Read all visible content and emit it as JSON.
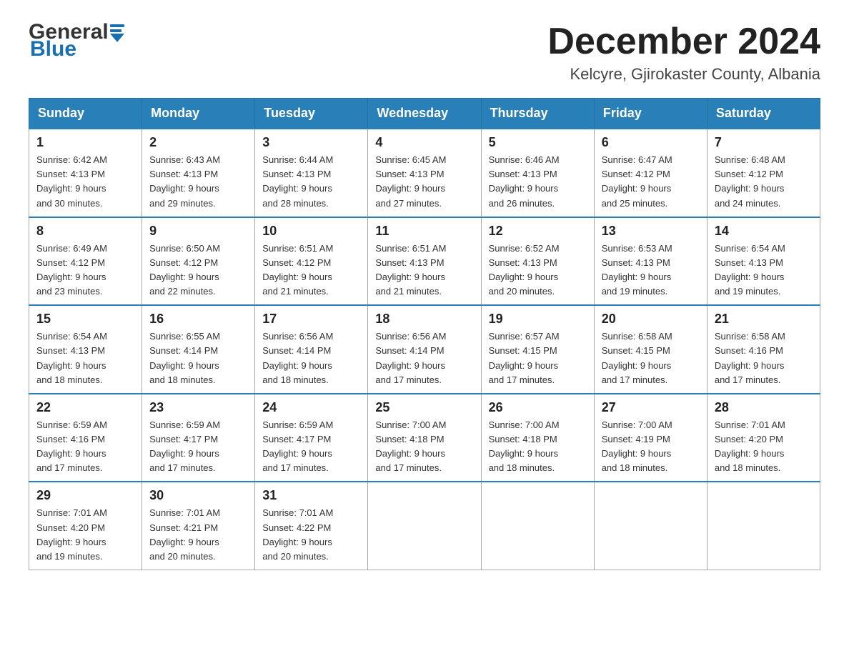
{
  "header": {
    "logo_general": "General",
    "logo_blue": "Blue",
    "month_title": "December 2024",
    "location": "Kelcyre, Gjirokaster County, Albania"
  },
  "days_of_week": [
    "Sunday",
    "Monday",
    "Tuesday",
    "Wednesday",
    "Thursday",
    "Friday",
    "Saturday"
  ],
  "weeks": [
    [
      {
        "day": "1",
        "sunrise": "6:42 AM",
        "sunset": "4:13 PM",
        "daylight": "9 hours and 30 minutes."
      },
      {
        "day": "2",
        "sunrise": "6:43 AM",
        "sunset": "4:13 PM",
        "daylight": "9 hours and 29 minutes."
      },
      {
        "day": "3",
        "sunrise": "6:44 AM",
        "sunset": "4:13 PM",
        "daylight": "9 hours and 28 minutes."
      },
      {
        "day": "4",
        "sunrise": "6:45 AM",
        "sunset": "4:13 PM",
        "daylight": "9 hours and 27 minutes."
      },
      {
        "day": "5",
        "sunrise": "6:46 AM",
        "sunset": "4:13 PM",
        "daylight": "9 hours and 26 minutes."
      },
      {
        "day": "6",
        "sunrise": "6:47 AM",
        "sunset": "4:12 PM",
        "daylight": "9 hours and 25 minutes."
      },
      {
        "day": "7",
        "sunrise": "6:48 AM",
        "sunset": "4:12 PM",
        "daylight": "9 hours and 24 minutes."
      }
    ],
    [
      {
        "day": "8",
        "sunrise": "6:49 AM",
        "sunset": "4:12 PM",
        "daylight": "9 hours and 23 minutes."
      },
      {
        "day": "9",
        "sunrise": "6:50 AM",
        "sunset": "4:12 PM",
        "daylight": "9 hours and 22 minutes."
      },
      {
        "day": "10",
        "sunrise": "6:51 AM",
        "sunset": "4:12 PM",
        "daylight": "9 hours and 21 minutes."
      },
      {
        "day": "11",
        "sunrise": "6:51 AM",
        "sunset": "4:13 PM",
        "daylight": "9 hours and 21 minutes."
      },
      {
        "day": "12",
        "sunrise": "6:52 AM",
        "sunset": "4:13 PM",
        "daylight": "9 hours and 20 minutes."
      },
      {
        "day": "13",
        "sunrise": "6:53 AM",
        "sunset": "4:13 PM",
        "daylight": "9 hours and 19 minutes."
      },
      {
        "day": "14",
        "sunrise": "6:54 AM",
        "sunset": "4:13 PM",
        "daylight": "9 hours and 19 minutes."
      }
    ],
    [
      {
        "day": "15",
        "sunrise": "6:54 AM",
        "sunset": "4:13 PM",
        "daylight": "9 hours and 18 minutes."
      },
      {
        "day": "16",
        "sunrise": "6:55 AM",
        "sunset": "4:14 PM",
        "daylight": "9 hours and 18 minutes."
      },
      {
        "day": "17",
        "sunrise": "6:56 AM",
        "sunset": "4:14 PM",
        "daylight": "9 hours and 18 minutes."
      },
      {
        "day": "18",
        "sunrise": "6:56 AM",
        "sunset": "4:14 PM",
        "daylight": "9 hours and 17 minutes."
      },
      {
        "day": "19",
        "sunrise": "6:57 AM",
        "sunset": "4:15 PM",
        "daylight": "9 hours and 17 minutes."
      },
      {
        "day": "20",
        "sunrise": "6:58 AM",
        "sunset": "4:15 PM",
        "daylight": "9 hours and 17 minutes."
      },
      {
        "day": "21",
        "sunrise": "6:58 AM",
        "sunset": "4:16 PM",
        "daylight": "9 hours and 17 minutes."
      }
    ],
    [
      {
        "day": "22",
        "sunrise": "6:59 AM",
        "sunset": "4:16 PM",
        "daylight": "9 hours and 17 minutes."
      },
      {
        "day": "23",
        "sunrise": "6:59 AM",
        "sunset": "4:17 PM",
        "daylight": "9 hours and 17 minutes."
      },
      {
        "day": "24",
        "sunrise": "6:59 AM",
        "sunset": "4:17 PM",
        "daylight": "9 hours and 17 minutes."
      },
      {
        "day": "25",
        "sunrise": "7:00 AM",
        "sunset": "4:18 PM",
        "daylight": "9 hours and 17 minutes."
      },
      {
        "day": "26",
        "sunrise": "7:00 AM",
        "sunset": "4:18 PM",
        "daylight": "9 hours and 18 minutes."
      },
      {
        "day": "27",
        "sunrise": "7:00 AM",
        "sunset": "4:19 PM",
        "daylight": "9 hours and 18 minutes."
      },
      {
        "day": "28",
        "sunrise": "7:01 AM",
        "sunset": "4:20 PM",
        "daylight": "9 hours and 18 minutes."
      }
    ],
    [
      {
        "day": "29",
        "sunrise": "7:01 AM",
        "sunset": "4:20 PM",
        "daylight": "9 hours and 19 minutes."
      },
      {
        "day": "30",
        "sunrise": "7:01 AM",
        "sunset": "4:21 PM",
        "daylight": "9 hours and 20 minutes."
      },
      {
        "day": "31",
        "sunrise": "7:01 AM",
        "sunset": "4:22 PM",
        "daylight": "9 hours and 20 minutes."
      },
      null,
      null,
      null,
      null
    ]
  ],
  "labels": {
    "sunrise": "Sunrise:",
    "sunset": "Sunset:",
    "daylight": "Daylight:"
  }
}
